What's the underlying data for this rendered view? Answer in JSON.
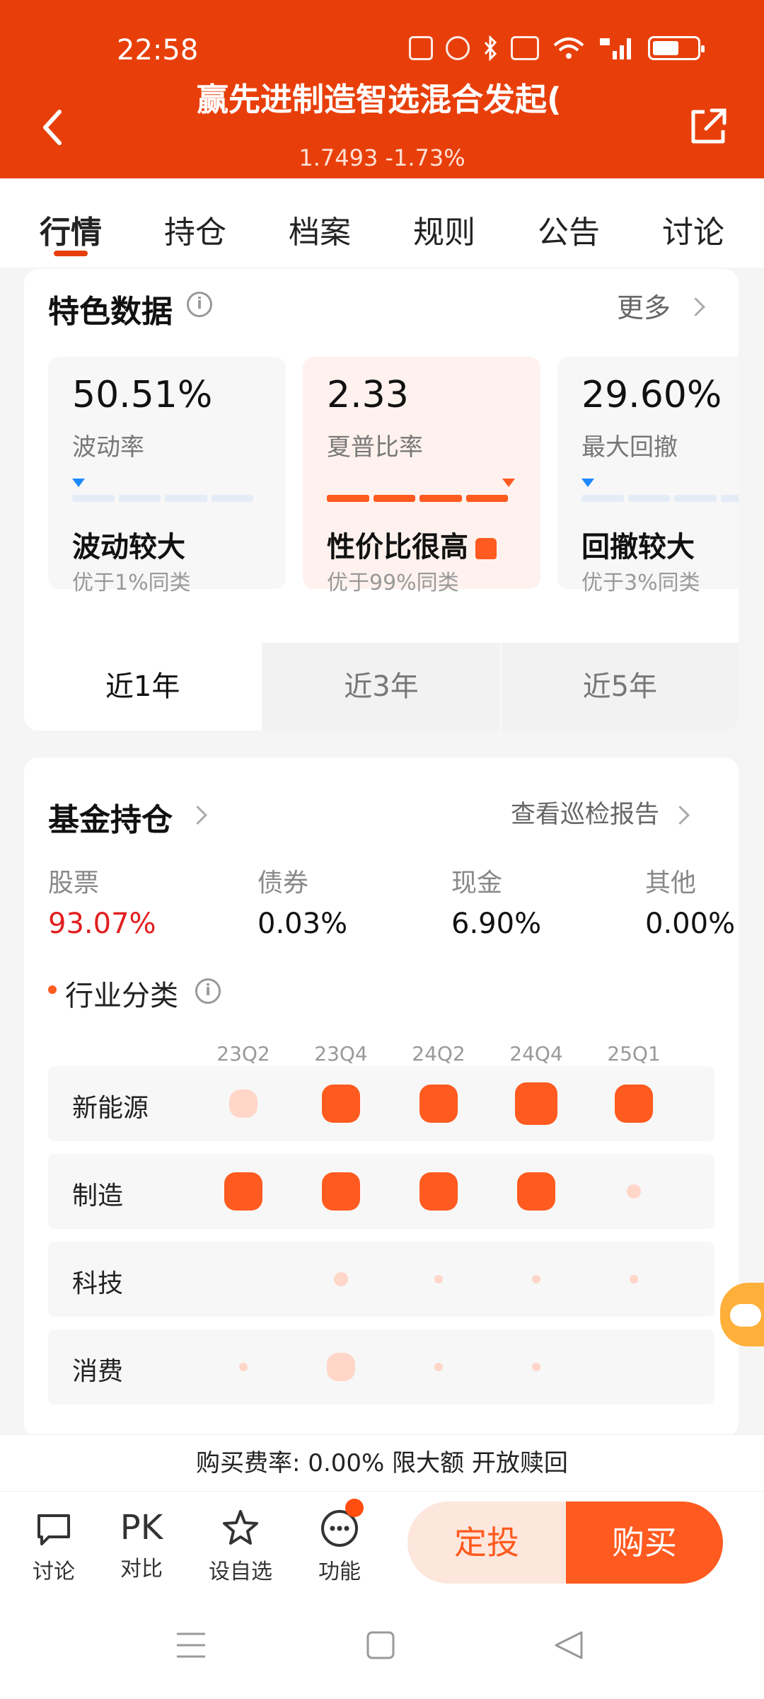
{
  "status": {
    "time": "22:58"
  },
  "header": {
    "title": "赢先进制造智选混合发起(",
    "subtitle": "1.7493 -1.73%"
  },
  "tabs": [
    {
      "label": "行情",
      "active": true
    },
    {
      "label": "持仓"
    },
    {
      "label": "档案"
    },
    {
      "label": "规则"
    },
    {
      "label": "公告"
    },
    {
      "label": "讨论"
    }
  ],
  "features": {
    "title": "特色数据",
    "more": "更多",
    "metrics": [
      {
        "value": "50.51%",
        "label": "波动率",
        "verdict": "波动较大",
        "rank": "优于1%同类",
        "level": 0.01
      },
      {
        "value": "2.33",
        "label": "夏普比率",
        "verdict": "性价比很高",
        "rank": "优于99%同类",
        "level": 0.99
      },
      {
        "value": "29.60%",
        "label": "最大回撤",
        "verdict": "回撤较大",
        "rank": "优于3%同类",
        "level": 0.03
      }
    ],
    "periods": [
      "近1年",
      "近3年",
      "近5年"
    ]
  },
  "holdings": {
    "title": "基金持仓",
    "report_link": "查看巡检报告",
    "assets": [
      {
        "label": "股票",
        "value": "93.07%"
      },
      {
        "label": "债券",
        "value": "0.03%"
      },
      {
        "label": "现金",
        "value": "6.90%"
      },
      {
        "label": "其他",
        "value": "0.00%"
      }
    ],
    "industry_title": "行业分类",
    "quarters": [
      "23Q2",
      "23Q4",
      "24Q2",
      "24Q4",
      "25Q1"
    ],
    "industries": [
      {
        "name": "新能源",
        "levels": [
          "sm-light",
          "md",
          "md",
          "lg",
          "md"
        ]
      },
      {
        "name": "制造",
        "levels": [
          "md",
          "md",
          "md",
          "md",
          "xs-light"
        ]
      },
      {
        "name": "科技",
        "levels": [
          "none",
          "xs-light",
          "tiny",
          "tiny",
          "tiny"
        ]
      },
      {
        "name": "消费",
        "levels": [
          "tiny",
          "sm-light",
          "tiny",
          "tiny",
          "none"
        ]
      }
    ]
  },
  "footer": {
    "fee_text": "购买费率: 0.00% 限大额 开放赎回",
    "actions": [
      {
        "label": "讨论",
        "icon": "chat-icon"
      },
      {
        "label": "对比",
        "icon": "pk-icon",
        "glyph": "PK"
      },
      {
        "label": "设自选",
        "icon": "star-icon"
      },
      {
        "label": "功能",
        "icon": "more-icon"
      }
    ],
    "fixed_invest": "定投",
    "buy": "购买"
  },
  "colors": {
    "brand": "#e83f0a",
    "accent": "#ff5a1f",
    "negative": "#e21f1f"
  }
}
